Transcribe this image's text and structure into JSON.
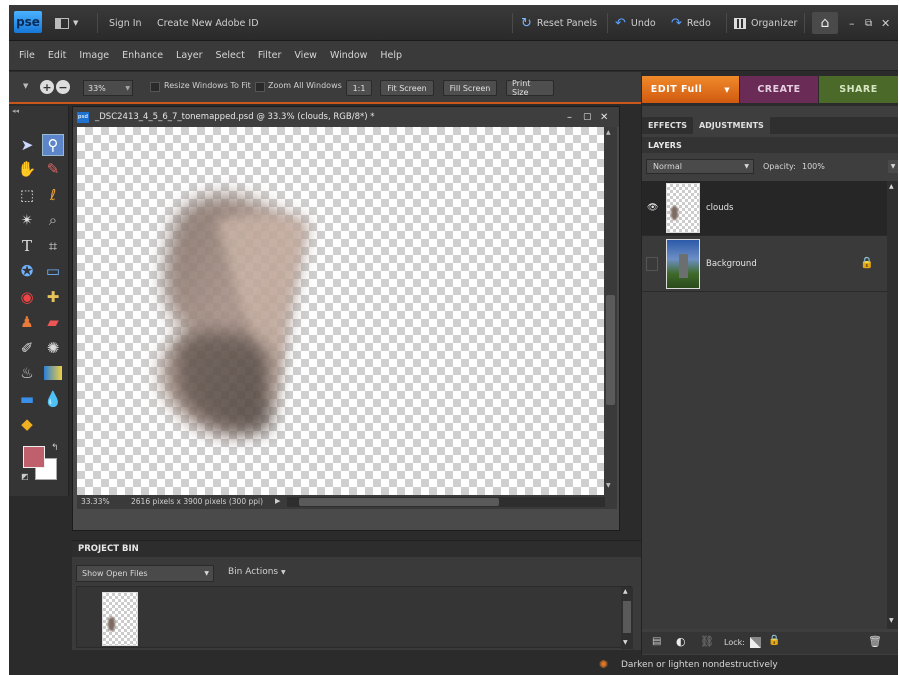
{
  "titlebar": {
    "logo": "pse",
    "sign_in": "Sign In",
    "create_id": "Create New Adobe ID",
    "reset_panels": "Reset Panels",
    "undo": "Undo",
    "redo": "Redo",
    "organizer": "Organizer"
  },
  "menu": [
    "File",
    "Edit",
    "Image",
    "Enhance",
    "Layer",
    "Select",
    "Filter",
    "View",
    "Window",
    "Help"
  ],
  "options": {
    "zoom_value": "33%",
    "resize_windows": "Resize Windows To Fit",
    "zoom_all_windows": "Zoom All Windows",
    "btn_1to1": "1:1",
    "btn_fit": "Fit Screen",
    "btn_fill": "Fill Screen",
    "btn_print": "Print Size"
  },
  "modes": {
    "edit": "EDIT Full",
    "create": "CREATE",
    "share": "SHARE"
  },
  "document": {
    "badge": "psd",
    "title": "_DSC2413_4_5_6_7_tonemapped.psd @ 33.3% (clouds, RGB/8*) *",
    "zoom_status": "33.33%",
    "size_status": "2616 pixels x 3900 pixels (300 ppi)"
  },
  "project_bin": {
    "title": "PROJECT BIN",
    "show_select": "Show Open Files",
    "bin_actions": "Bin Actions"
  },
  "panel": {
    "tab_effects": "EFFECTS",
    "tab_adjustments": "ADJUSTMENTS",
    "layers_title": "LAYERS",
    "blend_mode": "Normal",
    "opacity_label": "Opacity:",
    "opacity_value": "100%",
    "lock_label": "Lock:",
    "layers": [
      {
        "name": "clouds"
      },
      {
        "name": "Background"
      }
    ]
  },
  "statusbar": {
    "tip": "Darken or lighten nondestructively"
  },
  "colors": {
    "accent_orange": "#e06a1b",
    "create_purple": "#6e2d5a",
    "share_green": "#4e6b2a",
    "foreground_swatch": "#c0606c",
    "background_swatch": "#ffffff"
  }
}
